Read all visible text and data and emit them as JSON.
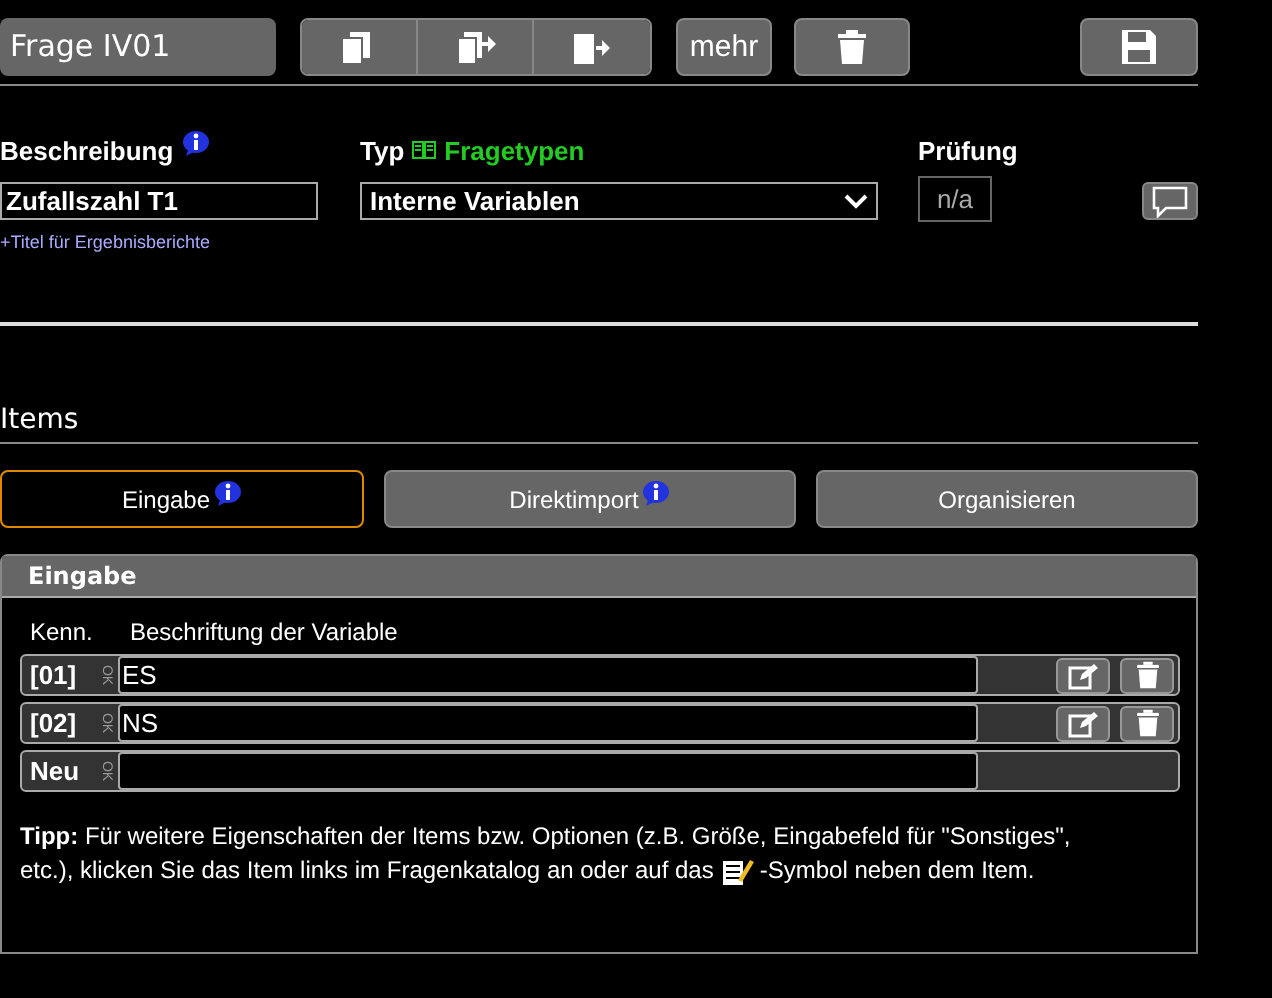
{
  "header": {
    "title": "Frage IV01",
    "more_label": "mehr"
  },
  "fields": {
    "description_label": "Beschreibung",
    "description_value": "Zufallszahl T1",
    "title_link": "+Titel für Ergebnisberichte",
    "type_label": "Typ",
    "type_link": "Fragetypen",
    "type_value": "Interne Variablen",
    "check_label": "Prüfung",
    "check_value": "n/a"
  },
  "items_title": "Items",
  "tabs": [
    {
      "label": "Eingabe",
      "info": true,
      "selected": true
    },
    {
      "label": "Direktimport",
      "info": true,
      "selected": false
    },
    {
      "label": "Organisieren",
      "info": false,
      "selected": false
    }
  ],
  "panel": {
    "title": "Eingabe",
    "columns": [
      "Kenn.",
      "Beschriftung der Variable"
    ],
    "rows": [
      {
        "kind": "item",
        "id": "[01]",
        "ok": "OK",
        "value": "ES"
      },
      {
        "kind": "item",
        "id": "[02]",
        "ok": "OK",
        "value": "NS"
      },
      {
        "kind": "new",
        "id": "Neu",
        "ok": "OK",
        "value": ""
      }
    ],
    "tip_line1": "**Tipp:** Für weitere Eigenschaften der Items bzw. Optionen (z.B. Größe, Eingabefeld für \"Sonstiges\",",
    "tip_before": "etc.), klicken Sie das Item links im Fragenkatalog an oder auf das",
    "tip_after": "-Symbol neben dem Item."
  }
}
